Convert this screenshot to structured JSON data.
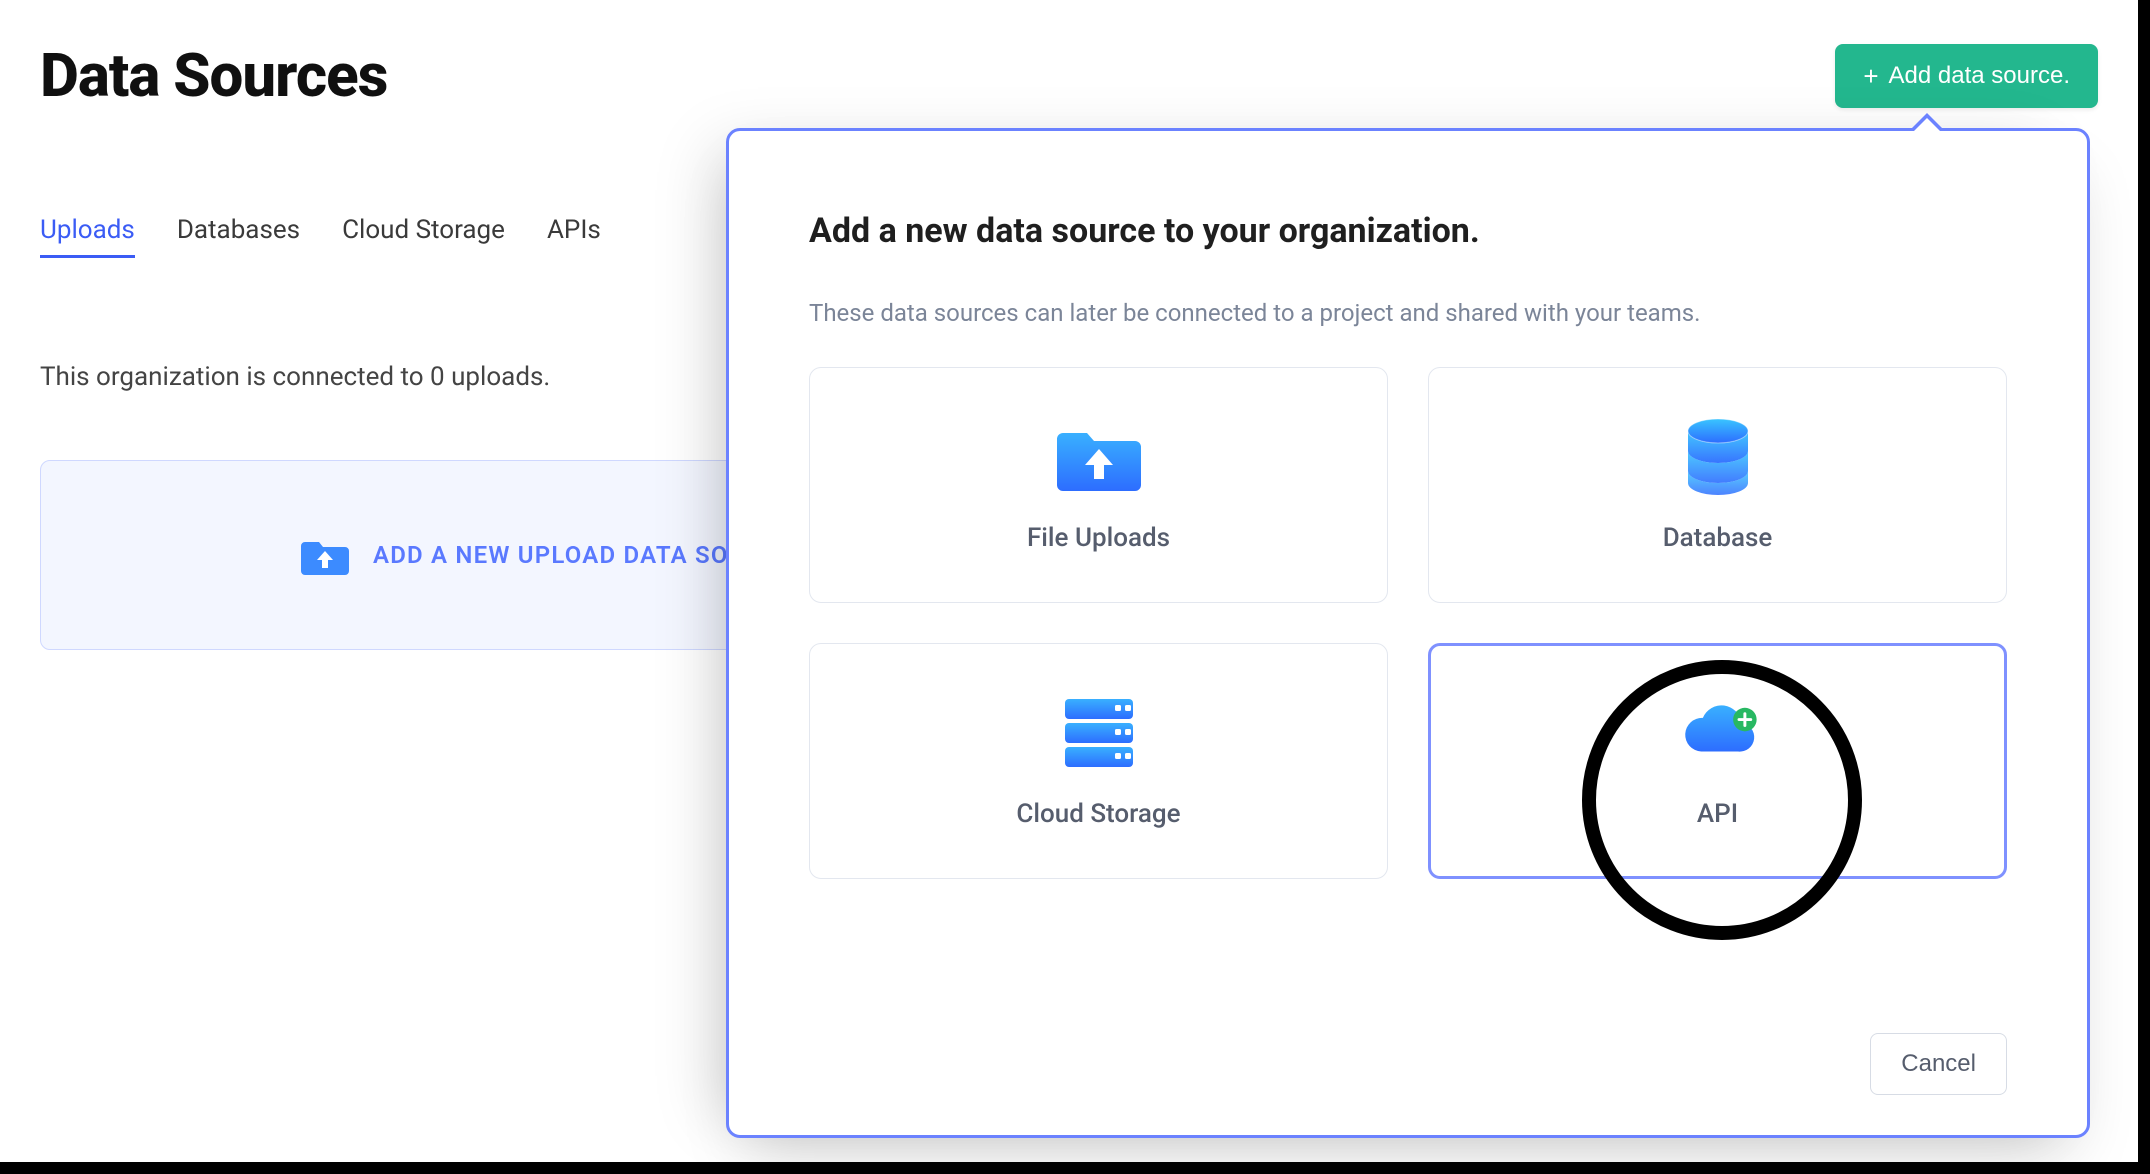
{
  "header": {
    "title": "Data Sources",
    "add_button_label": "Add data source."
  },
  "tabs": [
    {
      "label": "Uploads",
      "active": true
    },
    {
      "label": "Databases",
      "active": false
    },
    {
      "label": "Cloud Storage",
      "active": false
    },
    {
      "label": "APIs",
      "active": false
    }
  ],
  "status_text": "This organization is connected to 0 uploads.",
  "upload_placeholder_label": "ADD A NEW UPLOAD DATA SO",
  "popover": {
    "title": "Add a new data source to your organization.",
    "subtitle": "These data sources can later be connected to a project and shared with your teams.",
    "options": [
      {
        "label": "File Uploads",
        "icon": "folder-upload-icon",
        "selected": false
      },
      {
        "label": "Database",
        "icon": "database-icon",
        "selected": false
      },
      {
        "label": "Cloud Storage",
        "icon": "server-icon",
        "selected": false
      },
      {
        "label": "API",
        "icon": "cloud-api-icon",
        "selected": true
      }
    ],
    "cancel_label": "Cancel"
  }
}
